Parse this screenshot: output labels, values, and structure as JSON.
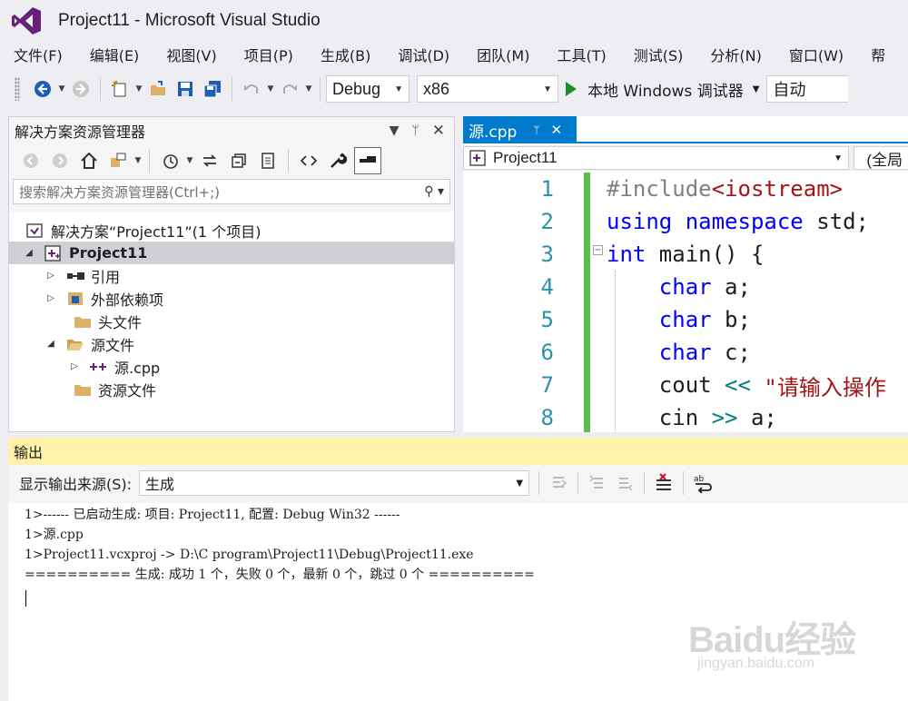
{
  "window": {
    "title": "Project11 - Microsoft Visual Studio"
  },
  "menu": [
    "文件(F)",
    "编辑(E)",
    "视图(V)",
    "项目(P)",
    "生成(B)",
    "调试(D)",
    "团队(M)",
    "工具(T)",
    "测试(S)",
    "分析(N)",
    "窗口(W)",
    "帮"
  ],
  "toolbar": {
    "config": "Debug",
    "platform": "x86",
    "run_label": "本地 Windows 调试器",
    "auto": "自动"
  },
  "solution_explorer": {
    "title": "解决方案资源管理器",
    "search_placeholder": "搜索解决方案资源管理器(Ctrl+;)",
    "tree": [
      {
        "label": "解决方案“Project11”(1 个项目)"
      },
      {
        "label": "Project11"
      },
      {
        "label": "引用"
      },
      {
        "label": "外部依赖项"
      },
      {
        "label": "头文件"
      },
      {
        "label": "源文件"
      },
      {
        "label": "源.cpp"
      },
      {
        "label": "资源文件"
      }
    ]
  },
  "editor": {
    "tab_label": "源.cpp",
    "nav_project": "Project11",
    "nav_scope": "(全局",
    "line_numbers": [
      "1",
      "2",
      "3",
      "4",
      "5",
      "6",
      "7",
      "8"
    ],
    "lines": {
      "l1_directive": "#include",
      "l1_header": "<iostream>",
      "l2_using": "using",
      "l2_namespace": "namespace",
      "l2_rest": " std;",
      "l3_int": "int",
      "l3_rest": " main() {",
      "l4_type": "char",
      "l4_rest": " a;",
      "l5_type": "char",
      "l5_rest": " b;",
      "l6_type": "char",
      "l6_rest": " c;",
      "l7_cout": "cout ",
      "l7_op": "<<",
      "l7_str": " \"请输入操作",
      "l8_cin": "cin ",
      "l8_op": ">>",
      "l8_rest": " a;"
    }
  },
  "output": {
    "title": "输出",
    "source_label": "显示输出来源(S):",
    "source_value": "生成",
    "lines": [
      "1>------ 已启动生成: 项目: Project11, 配置: Debug Win32 ------",
      "1>源.cpp",
      "1>Project11.vcxproj -> D:\\C program\\Project11\\Debug\\Project11.exe",
      "========== 生成: 成功 1 个，失败 0 个，最新 0 个，跳过 0 个 =========="
    ]
  },
  "watermark": {
    "main": "Baidu经验",
    "sub": "jingyan.baidu.com"
  },
  "colors": {
    "accent": "#007acc",
    "vs_purple": "#68217a",
    "output_header": "#fff1a8",
    "change_bar": "#57c14a",
    "keyword": "#0000ff"
  }
}
